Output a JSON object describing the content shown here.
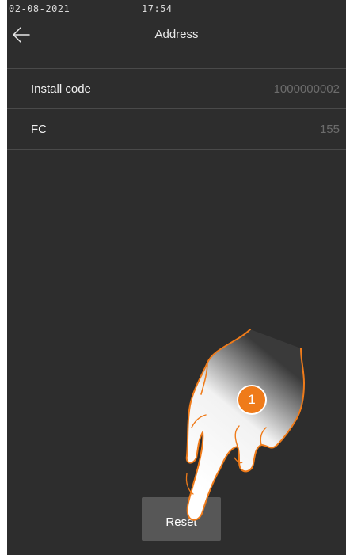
{
  "status_bar": {
    "date": "02-08-2021",
    "time": "17:54"
  },
  "header": {
    "title": "Address",
    "back_icon": "arrow-left-icon"
  },
  "settings": [
    {
      "label": "Install code",
      "value": "1000000002"
    },
    {
      "label": "FC",
      "value": "155"
    }
  ],
  "reset_label": "Reset",
  "annotation": {
    "step_number": "1"
  },
  "colors": {
    "background": "#2d2d2d",
    "button": "#575757",
    "accent": "#ef7b1a",
    "value_text": "#6c6c6c"
  }
}
